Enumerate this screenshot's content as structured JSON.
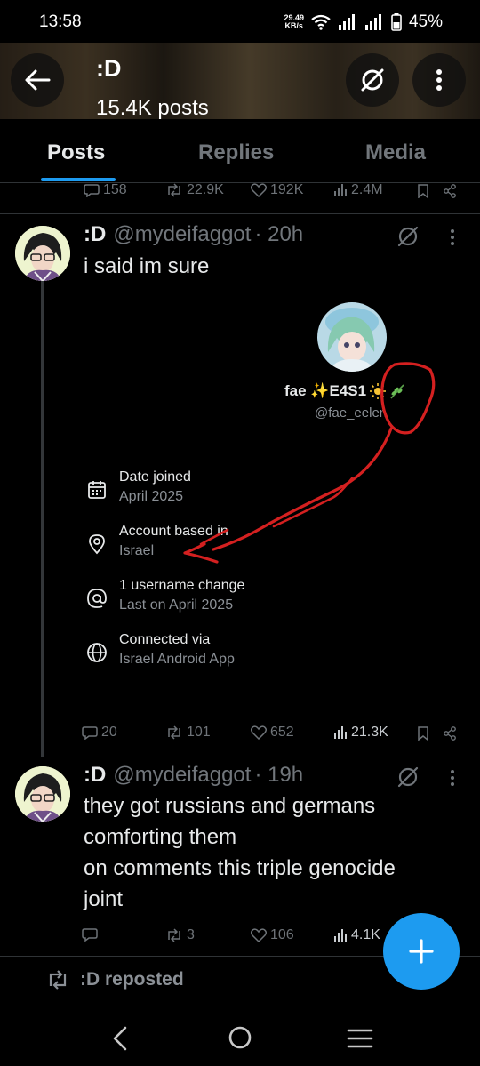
{
  "status_bar": {
    "time": "13:58",
    "net_speed_value": "29.49",
    "net_speed_unit": "KB/s",
    "battery": "45%"
  },
  "header": {
    "title": ":D",
    "post_count": "15.4K posts"
  },
  "tabs": [
    {
      "label": "Posts",
      "active": true
    },
    {
      "label": "Replies",
      "active": false
    },
    {
      "label": "Media",
      "active": false
    }
  ],
  "prev_post_stats": {
    "replies": "158",
    "reposts": "22.9K",
    "likes": "192K",
    "views": "2.4M"
  },
  "posts": [
    {
      "name": ":D",
      "handle": "@mydeifaggot",
      "time": "· 20h",
      "text": "i said im sure",
      "embedded_profile": {
        "display_name": "fae ✨E4S1",
        "handle": "@fae_eelen",
        "about": [
          {
            "icon": "calendar-icon",
            "title": "Date joined",
            "value": "April 2025"
          },
          {
            "icon": "location-icon",
            "title": "Account based in",
            "value": "Israel"
          },
          {
            "icon": "at-icon",
            "title": "1 username change",
            "value": "Last on April 2025"
          },
          {
            "icon": "globe-icon",
            "title": "Connected via",
            "value": "Israel Android App"
          }
        ]
      },
      "stats": {
        "replies": "20",
        "reposts": "101",
        "likes": "652",
        "views": "21.3K"
      }
    },
    {
      "name": ":D",
      "handle": "@mydeifaggot",
      "time": "· 19h",
      "text_lines": [
        "they got russians and germans",
        "comforting them",
        "on comments this triple genocide",
        "joint"
      ],
      "stats": {
        "replies": "",
        "reposts": "3",
        "likes": "106",
        "views": "4.1K"
      }
    }
  ],
  "repost_label": ":D reposted",
  "colors": {
    "accent": "#1d9bf0",
    "annotation": "#d42020",
    "background": "#000000"
  }
}
